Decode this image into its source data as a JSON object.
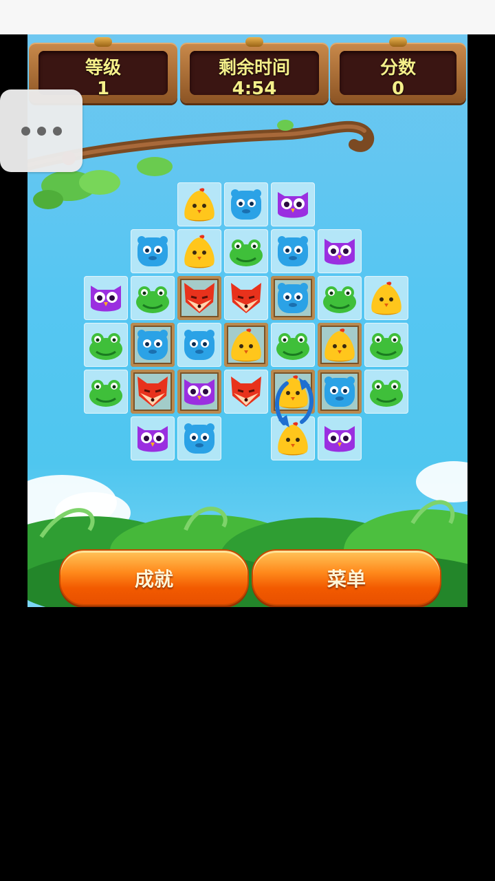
{
  "hud": {
    "level_label": "等级",
    "level_value": "1",
    "time_label": "剩余时间",
    "time_value": "4:54",
    "score_label": "分数",
    "score_value": "0"
  },
  "buttons": {
    "achievements": "成就",
    "menu": "菜单"
  },
  "tile_colors": {
    "chick": "#ffc61c",
    "blue": "#2ba2e6",
    "owl": "#9a2fe0",
    "frog": "#3fbf3a",
    "fox": "#e8321c"
  },
  "board": {
    "rows": [
      [
        null,
        null,
        "chick",
        "blue",
        "owl",
        null,
        null
      ],
      [
        null,
        "blue",
        "chick",
        "frog",
        "blue",
        "owl",
        null
      ],
      [
        "owl",
        "frog",
        "fox",
        "fox",
        "blue",
        "frog",
        "chick"
      ],
      [
        "frog",
        "blue",
        "blue",
        "chick",
        "frog",
        "chick",
        "frog"
      ],
      [
        "frog",
        "fox",
        "owl",
        "fox",
        "chick",
        "blue",
        "frog"
      ],
      [
        null,
        "owl",
        "blue",
        null,
        "chick",
        "owl",
        null
      ]
    ],
    "boxed": [
      [
        2,
        2
      ],
      [
        2,
        4
      ],
      [
        3,
        1
      ],
      [
        3,
        3
      ],
      [
        3,
        5
      ],
      [
        4,
        1
      ],
      [
        4,
        2
      ],
      [
        4,
        4
      ],
      [
        4,
        5
      ]
    ],
    "hint_swap": [
      [
        3,
        4
      ],
      [
        4,
        4
      ]
    ]
  }
}
